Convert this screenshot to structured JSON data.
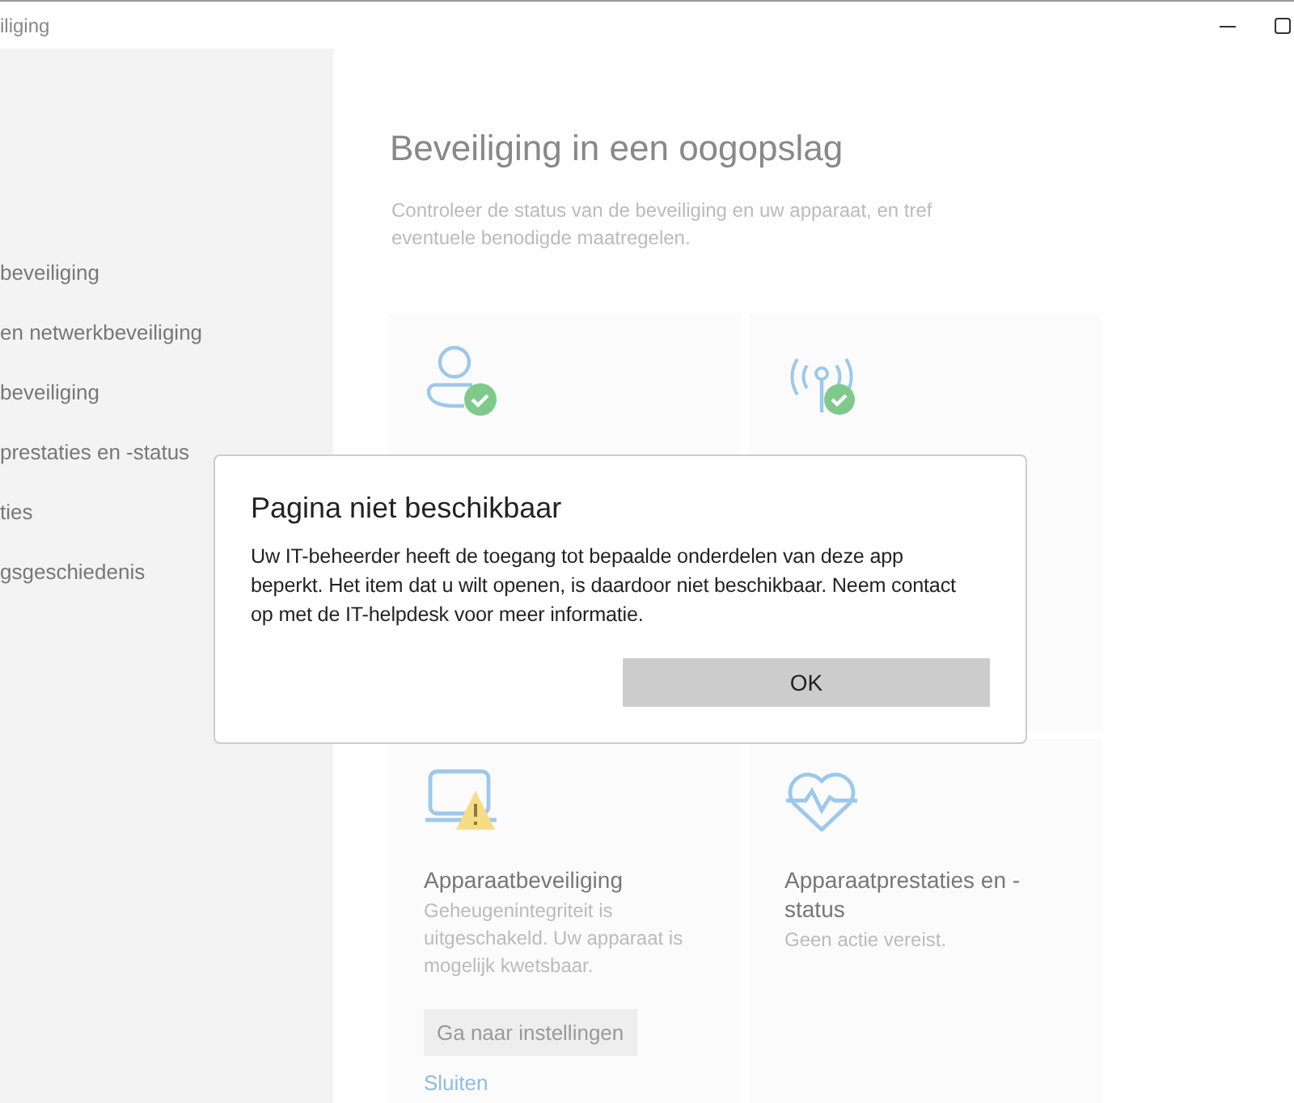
{
  "window": {
    "title": "iliging"
  },
  "sidebar": {
    "items": [
      {
        "label": "beveiliging"
      },
      {
        "label": "en netwerkbeveiliging"
      },
      {
        "label": "beveiliging"
      },
      {
        "label": "prestaties en -status"
      },
      {
        "label": "ties"
      },
      {
        "label": "gsgeschiedenis"
      }
    ]
  },
  "main": {
    "heading": "Beveiliging in een oogopslag",
    "subtitle": "Controleer de status van de beveiliging en uw apparaat, en tref eventuele benodigde maatregelen.",
    "cards": [
      {
        "kind": "account"
      },
      {
        "kind": "network"
      },
      {
        "kind": "device",
        "title": "Apparaatbeveiliging",
        "description": "Geheugenintegriteit is uitgeschakeld. Uw apparaat is mogelijk kwetsbaar.",
        "button": "Ga naar instellingen",
        "link": "Sluiten"
      },
      {
        "kind": "health",
        "title": "Apparaatprestaties en -status",
        "description": "Geen actie vereist."
      }
    ]
  },
  "dialog": {
    "title": "Pagina niet beschikbaar",
    "message": "Uw IT-beheerder heeft de toegang tot bepaalde onderdelen van deze app beperkt. Het item dat u wilt openen, is daardoor niet beschikbaar. Neem contact op met de IT-helpdesk voor meer informatie.",
    "button": "OK"
  }
}
